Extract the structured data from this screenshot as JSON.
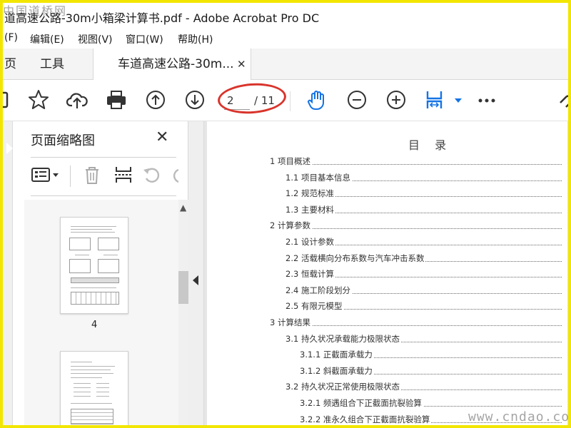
{
  "window": {
    "title": "道高速公路-30m小箱梁计算书.pdf - Adobe Acrobat Pro DC",
    "watermark_top": "中国道桥网",
    "watermark_bottom": "www.cndao.com"
  },
  "menubar": {
    "items": [
      {
        "label": "(F)"
      },
      {
        "label": "编辑(E)"
      },
      {
        "label": "视图(V)"
      },
      {
        "label": "窗口(W)"
      },
      {
        "label": "帮助(H)"
      }
    ]
  },
  "tabs": {
    "home": "页",
    "tools": "工具",
    "document": "车道高速公路-30m..."
  },
  "toolbar": {
    "current_page": "2",
    "total_pages": "/ 11",
    "accent": "#1473e6"
  },
  "thumbnails": {
    "title": "页面缩略图",
    "pages": [
      {
        "label": "4"
      }
    ]
  },
  "document": {
    "heading": "目  录",
    "toc": [
      {
        "label": "1  项目概述",
        "level": 0
      },
      {
        "label": "1.1  项目基本信息",
        "level": 1
      },
      {
        "label": "1.2  规范标准",
        "level": 1
      },
      {
        "label": "1.3  主要材料",
        "level": 1
      },
      {
        "label": "2  计算参数",
        "level": 0
      },
      {
        "label": "2.1  设计参数",
        "level": 1
      },
      {
        "label": "2.2  活载横向分布系数与汽车冲击系数",
        "level": 1
      },
      {
        "label": "2.3  恒载计算",
        "level": 1
      },
      {
        "label": "2.4  施工阶段划分",
        "level": 1
      },
      {
        "label": "2.5  有限元模型",
        "level": 1
      },
      {
        "label": "3  计算结果",
        "level": 0
      },
      {
        "label": "3.1  持久状况承载能力极限状态",
        "level": 1
      },
      {
        "label": "3.1.1  正截面承载力",
        "level": 2
      },
      {
        "label": "3.1.2  斜截面承载力",
        "level": 2
      },
      {
        "label": "3.2  持久状况正常使用极限状态",
        "level": 1
      },
      {
        "label": "3.2.1  频遇组合下正截面抗裂验算",
        "level": 2
      },
      {
        "label": "3.2.2  准永久组合下正截面抗裂验算",
        "level": 2
      }
    ]
  }
}
